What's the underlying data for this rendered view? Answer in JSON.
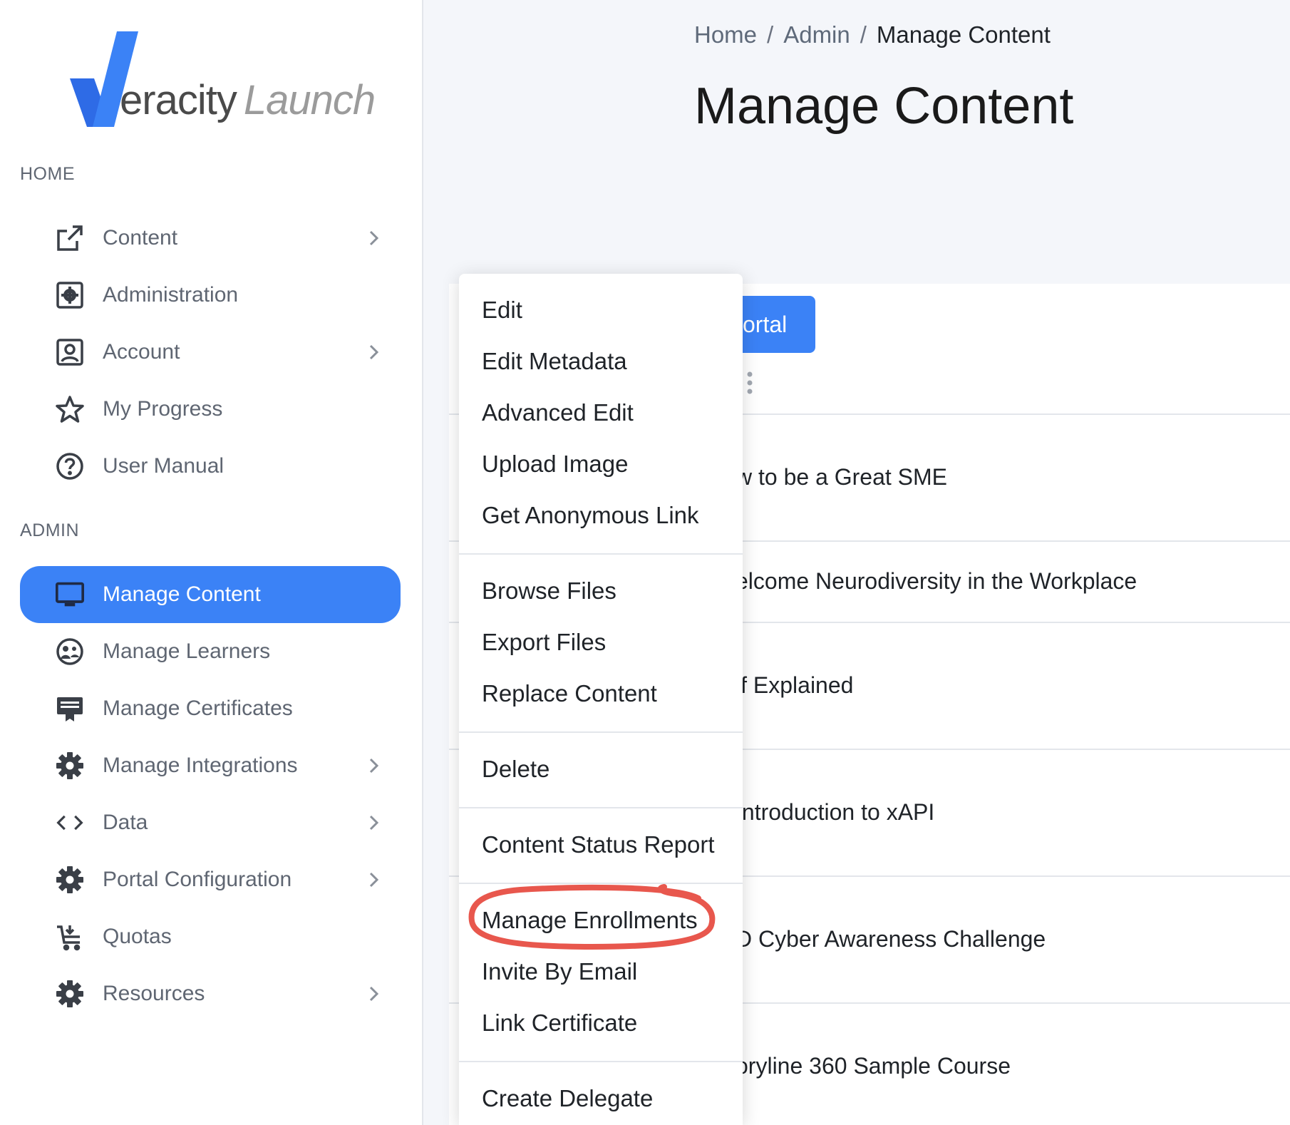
{
  "brand": {
    "logo_word1": "eracity",
    "logo_word2": "Launch",
    "accent_color": "#3b82f6"
  },
  "sidebar": {
    "home_label": "HOME",
    "admin_label": "ADMIN",
    "home_items": [
      {
        "label": "Content",
        "icon": "external-link-icon",
        "has_chevron": true
      },
      {
        "label": "Administration",
        "icon": "admin-gear-icon",
        "has_chevron": false
      },
      {
        "label": "Account",
        "icon": "account-icon",
        "has_chevron": true
      },
      {
        "label": "My Progress",
        "icon": "star-icon",
        "has_chevron": false
      },
      {
        "label": "User Manual",
        "icon": "help-circle-icon",
        "has_chevron": false
      }
    ],
    "admin_items": [
      {
        "label": "Manage Content",
        "icon": "monitor-icon",
        "active": true
      },
      {
        "label": "Manage Learners",
        "icon": "learners-icon"
      },
      {
        "label": "Manage Certificates",
        "icon": "certificate-icon"
      },
      {
        "label": "Manage Integrations",
        "icon": "gear-icon",
        "has_chevron": true
      },
      {
        "label": "Data",
        "icon": "code-icon",
        "has_chevron": true
      },
      {
        "label": "Portal Configuration",
        "icon": "gear-icon",
        "has_chevron": true
      },
      {
        "label": "Quotas",
        "icon": "cart-icon"
      },
      {
        "label": "Resources",
        "icon": "gear-icon",
        "has_chevron": true
      }
    ]
  },
  "breadcrumb": {
    "home": "Home",
    "admin": "Admin",
    "current": "Manage Content",
    "separator": "/"
  },
  "page_title": "Manage Content",
  "portal_button_visible_text": "ortal",
  "content_rows": [
    "w to be a Great SME",
    "elcome Neurodiversity in the Workplace",
    "lf Explained",
    "Introduction to xAPI",
    "D Cyber Awareness Challenge",
    "oryline 360 Sample Course"
  ],
  "context_menu": {
    "items": [
      "Edit",
      "Edit Metadata",
      "Advanced Edit",
      "Upload Image",
      "Get Anonymous Link",
      "Browse Files",
      "Export Files",
      "Replace Content",
      "Delete",
      "Content Status Report",
      "Manage Enrollments",
      "Invite By Email",
      "Link Certificate",
      "Create Delegate"
    ],
    "highlighted": "Manage Enrollments",
    "annotation_color": "#e8574d"
  }
}
